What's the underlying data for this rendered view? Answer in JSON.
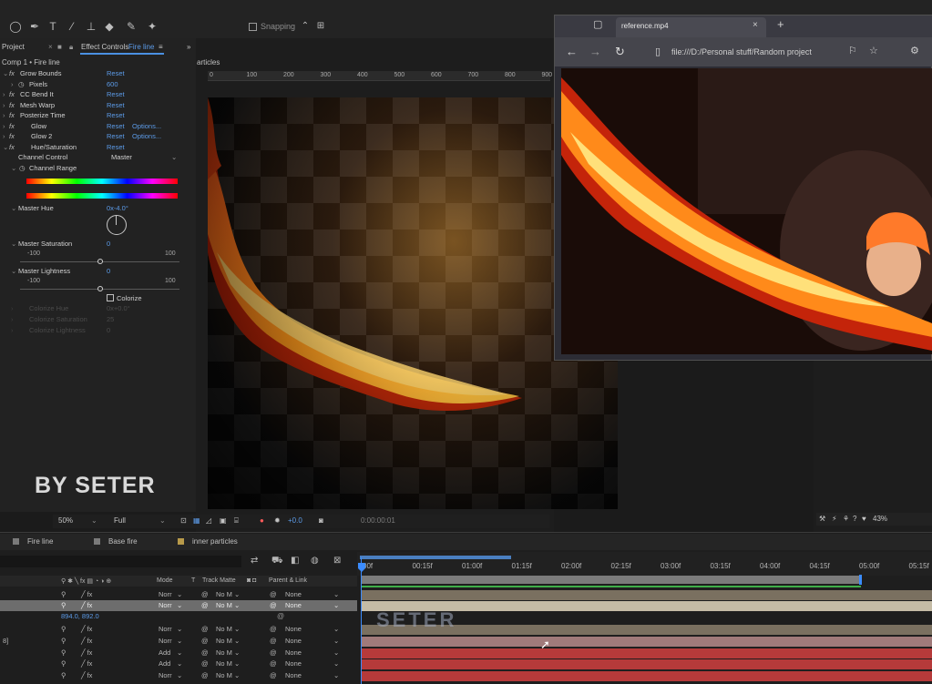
{
  "toolbar": {
    "snapping_label": "Snapping"
  },
  "effect_controls": {
    "tab_project": "Project",
    "tab_effect_controls": "Effect Controls",
    "tab_layer": "Fire line",
    "tab_menu": "≡",
    "expand": "»",
    "breadcrumb": "Comp 1 • Fire line",
    "reset_label": "Reset",
    "options_label": "Options...",
    "effects": [
      {
        "name": "Grow Bounds"
      },
      {
        "name": "Pixels",
        "value": "600",
        "is_param": true
      },
      {
        "name": "CC Bend It"
      },
      {
        "name": "Mesh Warp"
      },
      {
        "name": "Posterize Time"
      },
      {
        "name": "Glow",
        "options": true
      },
      {
        "name": "Glow 2",
        "options": true
      },
      {
        "name": "Hue/Saturation"
      }
    ],
    "channel_control_label": "Channel Control",
    "channel_control_value": "Master",
    "channel_range_label": "Channel Range",
    "master_hue_label": "Master Hue",
    "master_hue_value": "0x-4.0°",
    "master_saturation_label": "Master Saturation",
    "master_saturation_value": "0",
    "master_lightness_label": "Master Lightness",
    "master_lightness_value": "0",
    "slider_min": "-100",
    "slider_max": "100",
    "saturation_level": 0.5,
    "lightness_level": 0.5,
    "colorize_label": "Colorize",
    "colorize_hue_label": "Colorize Hue",
    "colorize_hue_value": "0x+0.0°",
    "colorize_saturation_label": "Colorize Saturation",
    "colorize_saturation_value": "25",
    "colorize_lightness_label": "Colorize Lightness",
    "colorize_lightness_value": "0"
  },
  "composition": {
    "panel_label": "articles",
    "ruler_labels": [
      "0",
      "100",
      "200",
      "300",
      "400",
      "500",
      "600",
      "700",
      "800",
      "900"
    ],
    "zoom": "50%",
    "resolution": "Full",
    "exposure": "+0.0",
    "timecode": "0:00:00:01"
  },
  "browser": {
    "tab_title": "reference.mp4",
    "new_tab": "+",
    "address": "file:///D:/Personal stuff/Random project"
  },
  "right_status": {
    "zoom_percent": "43%"
  },
  "timeline": {
    "tabs": [
      {
        "label": "Fire line",
        "color": "#7a7a7a"
      },
      {
        "label": "Base fire",
        "color": "#7a7a7a"
      },
      {
        "label": "inner particles",
        "color": "#b89a4a"
      }
    ],
    "header": {
      "mode": "Mode",
      "t": "T",
      "track_matte": "Track Matte",
      "parent_link": "Parent & Link"
    },
    "timecodes": [
      "00f",
      "00:15f",
      "01:00f",
      "01:15f",
      "02:00f",
      "02:15f",
      "03:00f",
      "03:15f",
      "04:00f",
      "04:15f",
      "05:00f",
      "05:15f"
    ],
    "position_value": "894.0, 892.0",
    "layers": [
      {
        "id": "",
        "mode": "Norr",
        "matte": "No M",
        "parent": "None",
        "selected": false,
        "track": "#7a7060"
      },
      {
        "id": "",
        "mode": "Norr",
        "matte": "No M",
        "parent": "None",
        "selected": true,
        "track": "#c5bca6"
      },
      {
        "id": "",
        "mode": "Norr",
        "matte": "No M",
        "parent": "None",
        "selected": false,
        "track": "#7a7060"
      },
      {
        "id": "8]",
        "mode": "Norr",
        "matte": "No M",
        "parent": "None",
        "selected": false,
        "track": "#a07a7a"
      },
      {
        "id": "",
        "mode": "Add",
        "matte": "No M",
        "parent": "None",
        "selected": false,
        "track": "#b63a3a"
      },
      {
        "id": "",
        "mode": "Add",
        "matte": "No M",
        "parent": "None",
        "selected": false,
        "track": "#b63a3a"
      },
      {
        "id": "",
        "mode": "Norr",
        "matte": "No M",
        "parent": "None",
        "selected": false,
        "track": "#b63a3a"
      }
    ]
  },
  "watermarks": {
    "left": "BY SETER",
    "center": "SETER"
  }
}
